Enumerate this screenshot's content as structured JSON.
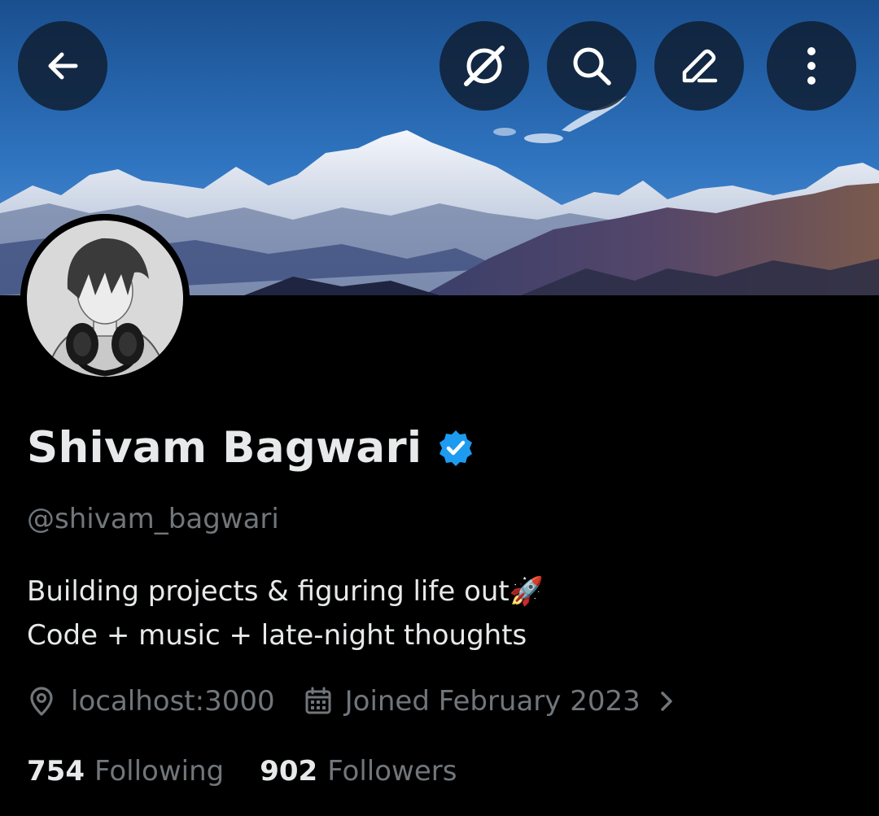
{
  "header": {
    "buttons": [
      {
        "name": "back",
        "icon": "arrow-left-icon"
      },
      {
        "name": "grok",
        "icon": "grok-icon"
      },
      {
        "name": "search",
        "icon": "search-icon"
      },
      {
        "name": "edit",
        "icon": "pencil-icon"
      },
      {
        "name": "more",
        "icon": "more-vertical-icon"
      }
    ]
  },
  "profile": {
    "display_name": "Shivam Bagwari",
    "verified": true,
    "handle": "@shivam_bagwari",
    "bio_line1": "Building projects & figuring life out🚀",
    "bio_line2": "Code + music + late-night thoughts",
    "location": "localhost:3000",
    "joined": "Joined February 2023"
  },
  "stats": {
    "following_count": "754",
    "following_label": "Following",
    "followers_count": "902",
    "followers_label": "Followers"
  },
  "colors": {
    "background": "#000000",
    "primary_text": "#e7e9ea",
    "secondary_text": "#71767b",
    "verified_blue": "#1d9bf0"
  }
}
